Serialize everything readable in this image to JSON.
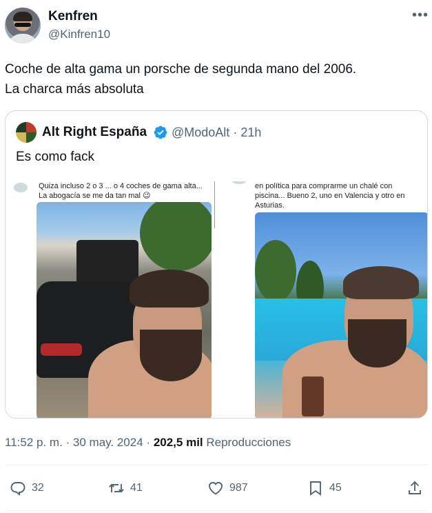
{
  "tweet": {
    "author_name": "Kenfren",
    "author_handle": "@Kinfren10",
    "text_line1": "Coche de alta gama un porsche de segunda mano del 2006.",
    "text_line2": "La charca más absoluta",
    "timestamp_time": "11:52 p. m.",
    "timestamp_date": "30 may. 2024",
    "views_count": "202,5 mil",
    "views_label": "Reproducciones"
  },
  "quote": {
    "author_name": "Alt Right España",
    "author_handle": "@ModoAlt",
    "age": "21h",
    "text": "Es como fack",
    "left_caption_line1": "Quiza incluso 2 o 3 ... o 4 coches de gama alta...",
    "left_caption_line2": "La abogacía se me da tan mal 😉",
    "right_caption_line1": "en política para  comprarme un chalé con",
    "right_caption_line2": "piscina... Bueno 2, uno en Valencia y otro en",
    "right_caption_line3": "Asturias."
  },
  "actions": {
    "replies": "32",
    "retweets": "41",
    "likes": "987",
    "bookmarks": "45"
  },
  "icons": [
    "more-icon",
    "verified-icon",
    "reply-icon",
    "retweet-icon",
    "like-icon",
    "bookmark-icon",
    "share-icon"
  ],
  "colors": {
    "verified": "#1d9bf0",
    "muted": "#536471"
  }
}
